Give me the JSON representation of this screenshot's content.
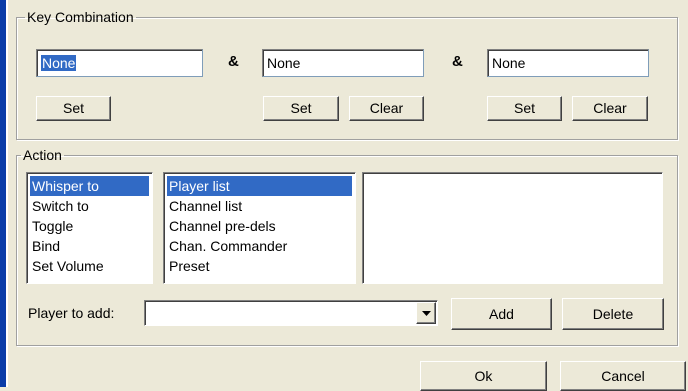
{
  "key_combination": {
    "legend": "Key Combination",
    "keys": [
      {
        "value": "None",
        "set_label": "Set"
      },
      {
        "value": "None",
        "set_label": "Set",
        "clear_label": "Clear"
      },
      {
        "value": "None",
        "set_label": "Set",
        "clear_label": "Clear"
      }
    ],
    "separator": "&"
  },
  "action": {
    "legend": "Action",
    "action_types": [
      "Whisper to",
      "Switch to",
      "Toggle",
      "Bind",
      "Set Volume"
    ],
    "targets": [
      "Player list",
      "Channel list",
      "Channel pre-dels",
      "Chan. Commander",
      "Preset"
    ],
    "player_to_add_label": "Player to add:",
    "player_to_add_value": "",
    "add_label": "Add",
    "delete_label": "Delete"
  },
  "dialog": {
    "ok_label": "Ok",
    "cancel_label": "Cancel"
  },
  "colors": {
    "selection": "#316ac5",
    "window_bg": "#ece9d8",
    "frame_blue": "#0a3ca8"
  }
}
